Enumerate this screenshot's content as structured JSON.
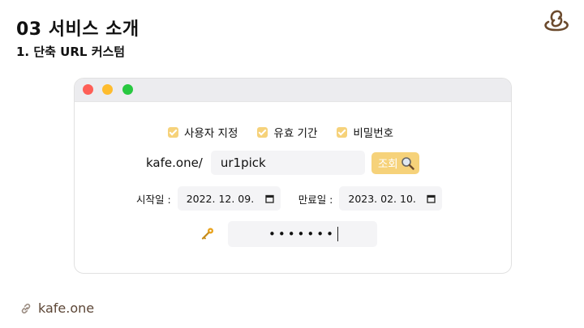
{
  "header": {
    "title": "03 서비스 소개",
    "subtitle": "1. 단축 URL 커스텀"
  },
  "colors": {
    "accent": "#f6d27a",
    "brand": "#6b4a2d",
    "field_bg": "#f4f4f6"
  },
  "window": {
    "controls": [
      "close",
      "minimize",
      "maximize"
    ],
    "options": [
      {
        "label": "사용자 지정",
        "checked": true
      },
      {
        "label": "유효 기간",
        "checked": true
      },
      {
        "label": "비밀번호",
        "checked": true
      }
    ],
    "url": {
      "prefix": "kafe.one/",
      "value": "ur1pick",
      "search_label": "조회",
      "search_icon": "magnifier-icon"
    },
    "dates": {
      "start_label": "시작일 :",
      "start_value": "2022. 12. 09.",
      "end_label": "만료일 :",
      "end_value": "2023. 02. 10.",
      "calendar_icon": "calendar-icon"
    },
    "password": {
      "icon": "key-icon",
      "masked": "•••••••"
    }
  },
  "footer": {
    "icon": "link-icon",
    "text": "kafe.one"
  }
}
